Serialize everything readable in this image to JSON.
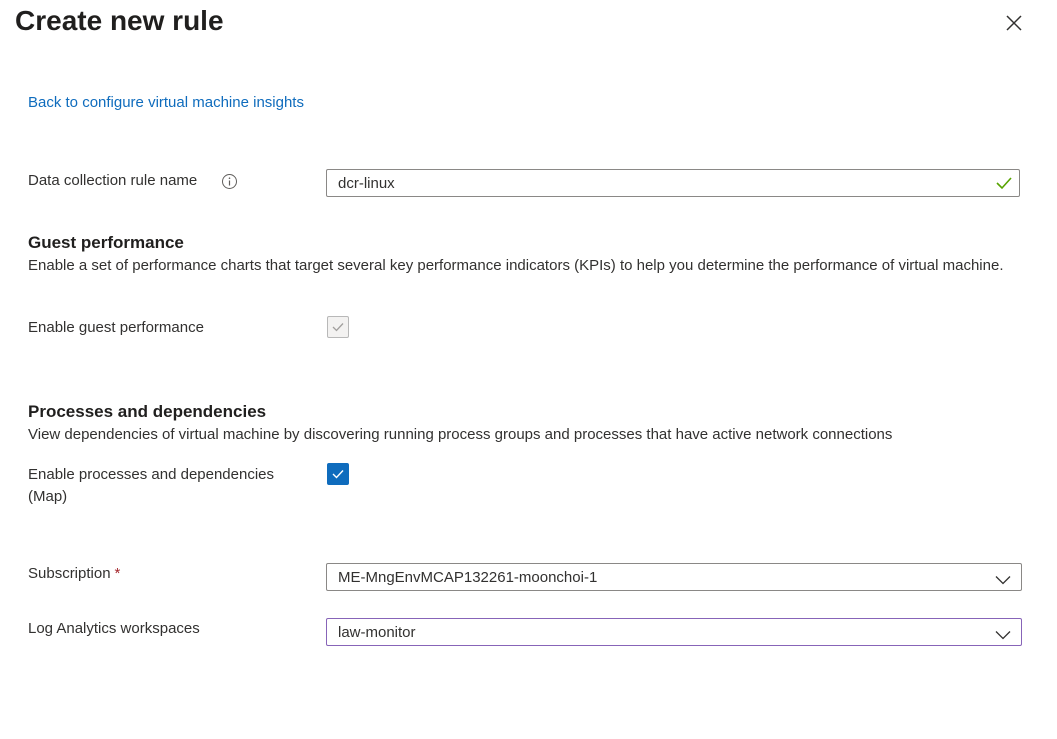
{
  "panel": {
    "title": "Create new rule",
    "back_link": "Back to configure virtual machine insights"
  },
  "rule_name": {
    "label": "Data collection rule name",
    "value": "dcr-linux",
    "valid": true
  },
  "guest_performance": {
    "title": "Guest performance",
    "description": "Enable a set of performance charts that target several key performance indicators (KPIs) to help you determine the performance of virtual machine.",
    "enable_label": "Enable guest performance",
    "enabled": true,
    "disabled": true
  },
  "processes": {
    "title": "Processes and dependencies",
    "description": "View dependencies of virtual machine by discovering running process groups and processes that have active network connections",
    "enable_label_line1": "Enable processes and dependencies",
    "enable_label_line2": "(Map)",
    "enabled": true
  },
  "subscription": {
    "label": "Subscription",
    "required_mark": "*",
    "value": "ME-MngEnvMCAP132261-moonchoi-1"
  },
  "workspace": {
    "label": "Log Analytics workspaces",
    "value": "law-monitor"
  },
  "icons": {
    "close": "close-icon",
    "info": "info-icon",
    "valid": "checkmark-icon",
    "dropdown": "chevron-down-icon"
  },
  "colors": {
    "link": "#0f6cbd",
    "checkbox_checked": "#0f6cbd",
    "valid_check": "#57a300",
    "focus_border": "#8764b8",
    "required": "#a4262c"
  }
}
